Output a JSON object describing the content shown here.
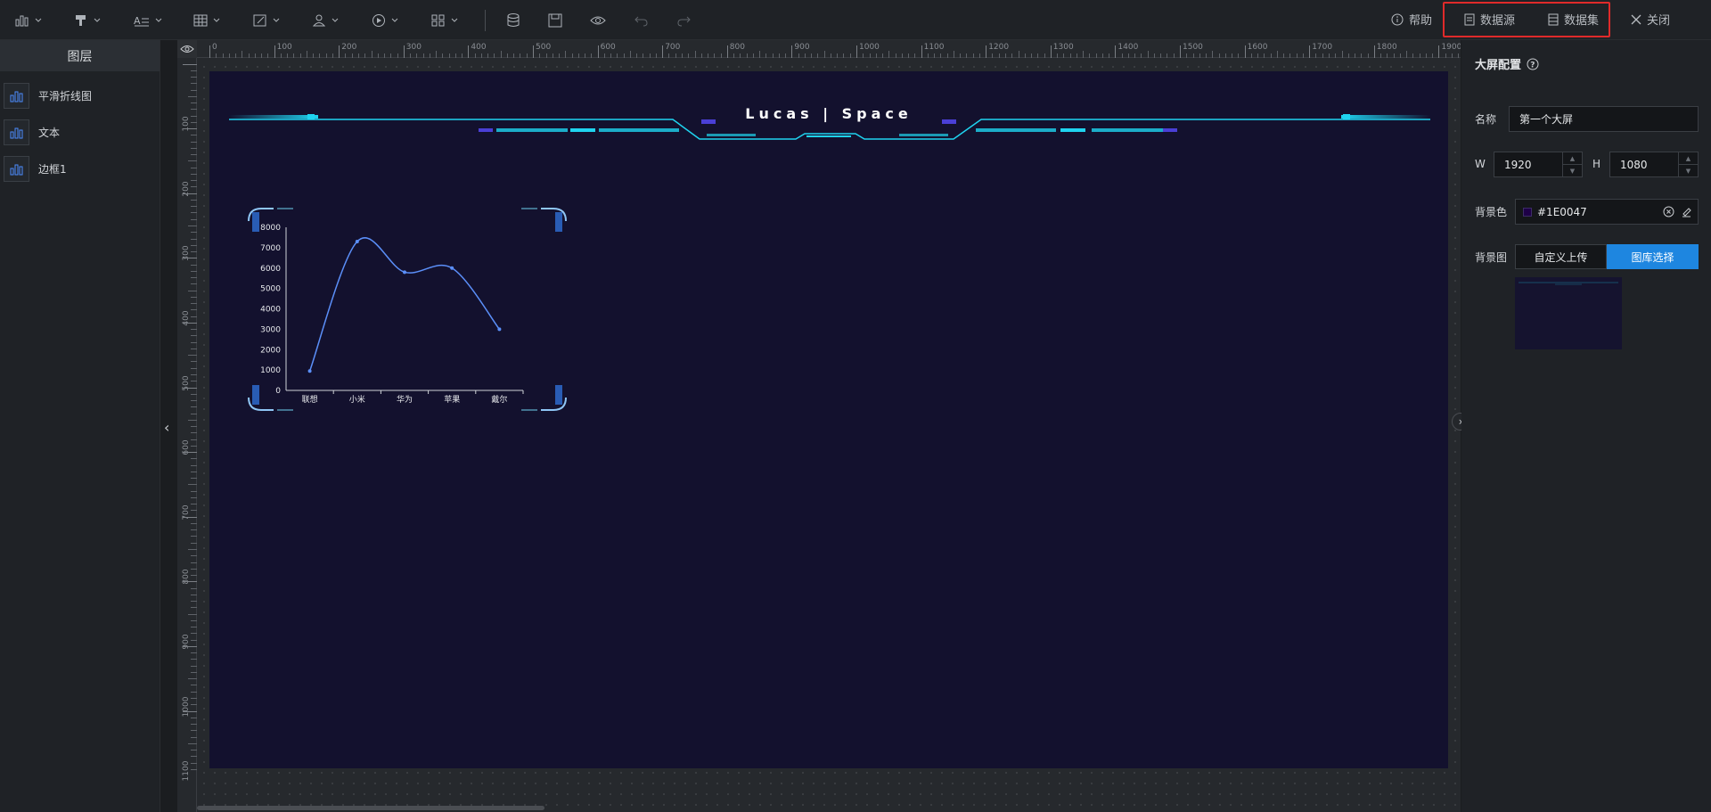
{
  "toolbar": {
    "help": "帮助",
    "datasource": "数据源",
    "dataset": "数据集",
    "close": "关闭",
    "tools": [
      "chart-tool-icon",
      "brush-tool-icon",
      "text-tool-icon",
      "table-tool-icon",
      "edit-tool-icon",
      "user-tool-icon",
      "media-tool-icon",
      "grid-tool-icon"
    ]
  },
  "sidebar": {
    "title": "图层",
    "layers": [
      {
        "label": "平滑折线图"
      },
      {
        "label": "文本"
      },
      {
        "label": "边框1"
      }
    ]
  },
  "ruler": {
    "top": [
      "0",
      "100",
      "200",
      "300",
      "400",
      "500",
      "600",
      "700",
      "800",
      "900",
      "1000",
      "1100",
      "1200",
      "1300",
      "1400",
      "1500",
      "1600",
      "1700",
      "1800",
      "1900"
    ],
    "left": [
      "100",
      "200",
      "300",
      "400",
      "500",
      "600",
      "700",
      "800",
      "900",
      "1000",
      "1100"
    ]
  },
  "screen": {
    "header_title": "Lucas | Space",
    "background_color": "#13112e",
    "accent": "#1fd4f0"
  },
  "chart_data": {
    "type": "line",
    "smooth": true,
    "categories": [
      "联想",
      "小米",
      "华为",
      "苹果",
      "戴尔"
    ],
    "values": [
      950,
      7300,
      5800,
      6000,
      3000
    ],
    "ylim": [
      0,
      8000
    ],
    "yticks": [
      "8000",
      "7000",
      "6000",
      "5000",
      "4000",
      "3000",
      "2000",
      "1000",
      "0"
    ],
    "line_color": "#5b8ff9"
  },
  "panel": {
    "title": "大屏配置",
    "name_label": "名称",
    "name_value": "第一个大屏",
    "w_label": "W",
    "w_value": "1920",
    "h_label": "H",
    "h_value": "1080",
    "bgcolor_label": "背景色",
    "bgcolor_value": "#1E0047",
    "bgimage_label": "背景图",
    "tab_custom": "自定义上传",
    "tab_library": "图库选择",
    "tab_active_color": "#1e86e0"
  }
}
